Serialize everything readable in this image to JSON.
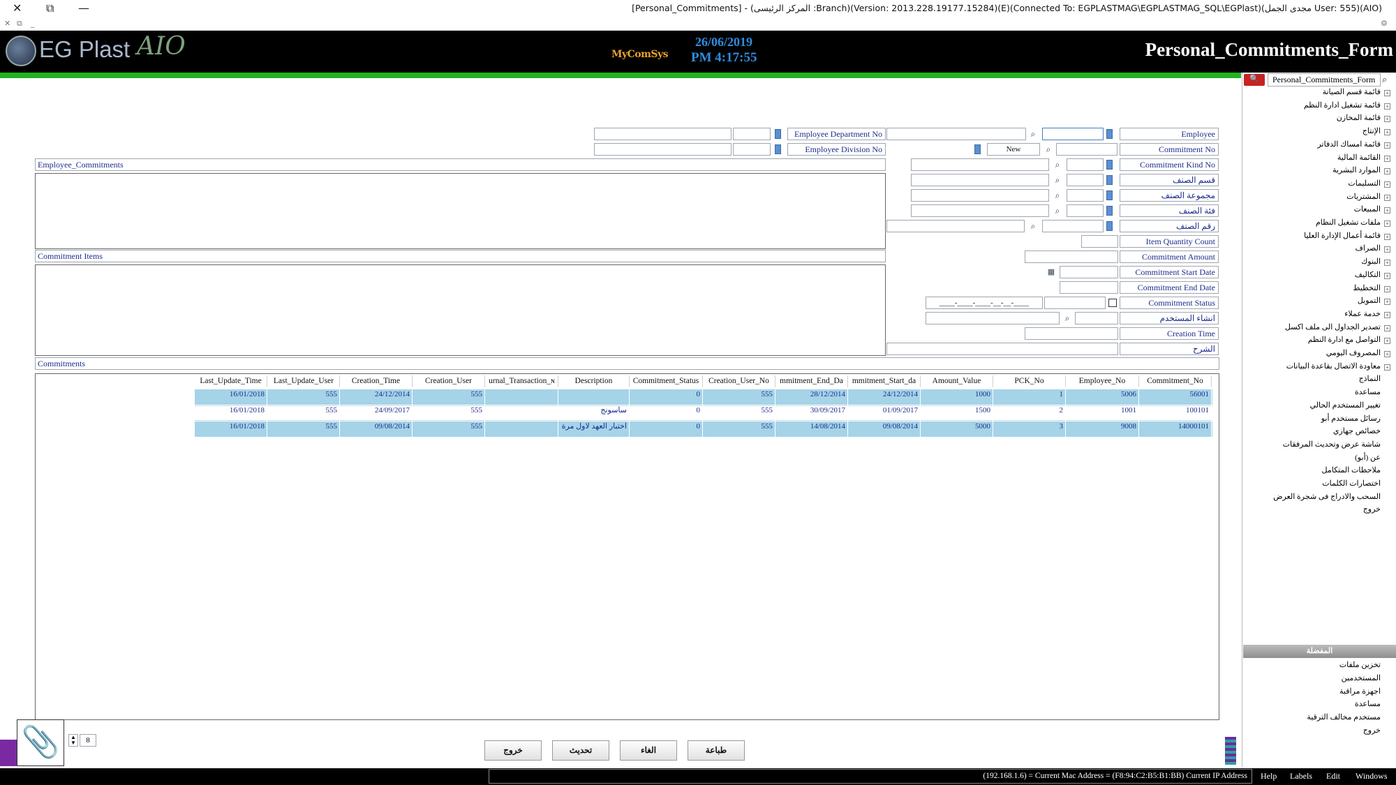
{
  "window": {
    "title": "[Personal_Commitments] - (المركز الرئيسى :Branch)(Version: 2013.228.19177.15284)(E)(Connected To: EGPLASTMAG\\EGPLASTMAG_SQL\\EGPlast)(مجدى الجمل User: 555)(AIO)",
    "close": "✕",
    "restore": "⧉",
    "minimize": "—"
  },
  "header": {
    "logo_text": "EG Plast",
    "logo_script": "AIO",
    "brand": "MyComSys",
    "date": "26/06/2019",
    "time": "PM 4:17:55",
    "form_title": "Personal_Commitments_Form"
  },
  "search": {
    "value": "Personal_Commitments_Form"
  },
  "tree": [
    "قائمة قسم الصيانة",
    "قائمة تشغيل ادارة النظم",
    "قائمة المخازن",
    "الإنتاج",
    "قائمة امساك الدفاتر",
    "القائمة المالية",
    "الموارد البشرية",
    "التسليمات",
    "المشتريات",
    "المبيعات",
    "ملفات تشغيل النظام",
    "قائمة أعمال الإدارة العليا",
    "الصراف",
    "البنوك",
    "التكاليف",
    "التخطيط",
    "التمويل",
    "خدمة عملاء",
    "تصدير الجداول الى ملف اكسل",
    "التواصل مع ادارة النظم",
    "المصروف اليومي",
    "معاودة الاتصال بقاعدة البيانات",
    "النماذج",
    "مساعدة",
    "تغيير المستخدم الحالي",
    "رسائل مستخدم أبو",
    "خصائص جهازي",
    "شاشة عرض وتحديث المرفقات",
    "عن (أبو)",
    "ملاحظات المتكامل",
    "اختصارات الكلمات",
    "السحب والادراج فى شجرة العرض",
    "خروج"
  ],
  "bottom_panel": {
    "title": "المفضلة",
    "items": [
      "تخزين ملفات",
      "المستخدمين",
      "اجهزة مراقبة",
      "مساعدة",
      "مستخدم مخالف الترقية",
      "خروج"
    ]
  },
  "form": {
    "employee": "Employee",
    "employee_department_no": "Employee Department No",
    "employee_division_no": "Employee Division No",
    "commitment_no": "Commitment No",
    "new_label": "New",
    "commitment_kind_no": "Commitment Kind No",
    "item_dept": "قسم الصنف",
    "item_group": "مجموعة الصنف",
    "item_class": "فئة الصنف",
    "item_no": "رقم الصنف",
    "item_quantity_count": "Item Quantity Count",
    "commitment_amount": "Commitment Amount",
    "commitment_start_date": "Commitment Start Date",
    "commitment_end_date": "Commitment End Date",
    "commitment_status": "Commitment Status",
    "status_mask": "____-____-____-__-__-____",
    "created_by": "انشاء المستخدم",
    "creation_time": "Creation Time",
    "description": "الشرح"
  },
  "sections": {
    "employee_commitments": "Employee_Commitments",
    "commitment_items": "Commitment Items",
    "commitments": "Commitments"
  },
  "grid": {
    "columns": [
      "Last_Update_Time",
      "Last_Update_User",
      "Creation_Time",
      "Creation_User",
      "urnal_Transaction_ɴ",
      "Description",
      "Commitment_Status",
      "Creation_User_No",
      "mmitment_End_Da",
      "mmitment_Start_da",
      "Amount_Value",
      "PCK_No",
      "Employee_No",
      "Commitment_No"
    ],
    "rows": [
      [
        "16/01/2018",
        "555",
        "24/12/2014",
        "555",
        "",
        "",
        "0",
        "555",
        "28/12/2014",
        "24/12/2014",
        "1000",
        "1",
        "5006",
        "56001"
      ],
      [
        "16/01/2018",
        "555",
        "24/09/2017",
        "555",
        "",
        "ساسونج",
        "0",
        "555",
        "30/09/2017",
        "01/09/2017",
        "1500",
        "2",
        "1001",
        "100101"
      ],
      [
        "16/01/2018",
        "555",
        "09/08/2014",
        "555",
        "",
        "اختبار العهد لاول مرة",
        "0",
        "555",
        "14/08/2014",
        "09/08/2014",
        "5000",
        "3",
        "9008",
        "14000101"
      ]
    ]
  },
  "pager": {
    "value": "8"
  },
  "buttons": {
    "exit": "خروج",
    "refresh": "تحديث",
    "cancel": "الغاء",
    "print": "طباعة"
  },
  "status": {
    "text": "(192.168.1.6) = Current Mac Address = (F8:94:C2:B5:B1:BB) Current IP Address",
    "menu": [
      "Help",
      "Labels",
      "Edit",
      "Windows"
    ]
  }
}
